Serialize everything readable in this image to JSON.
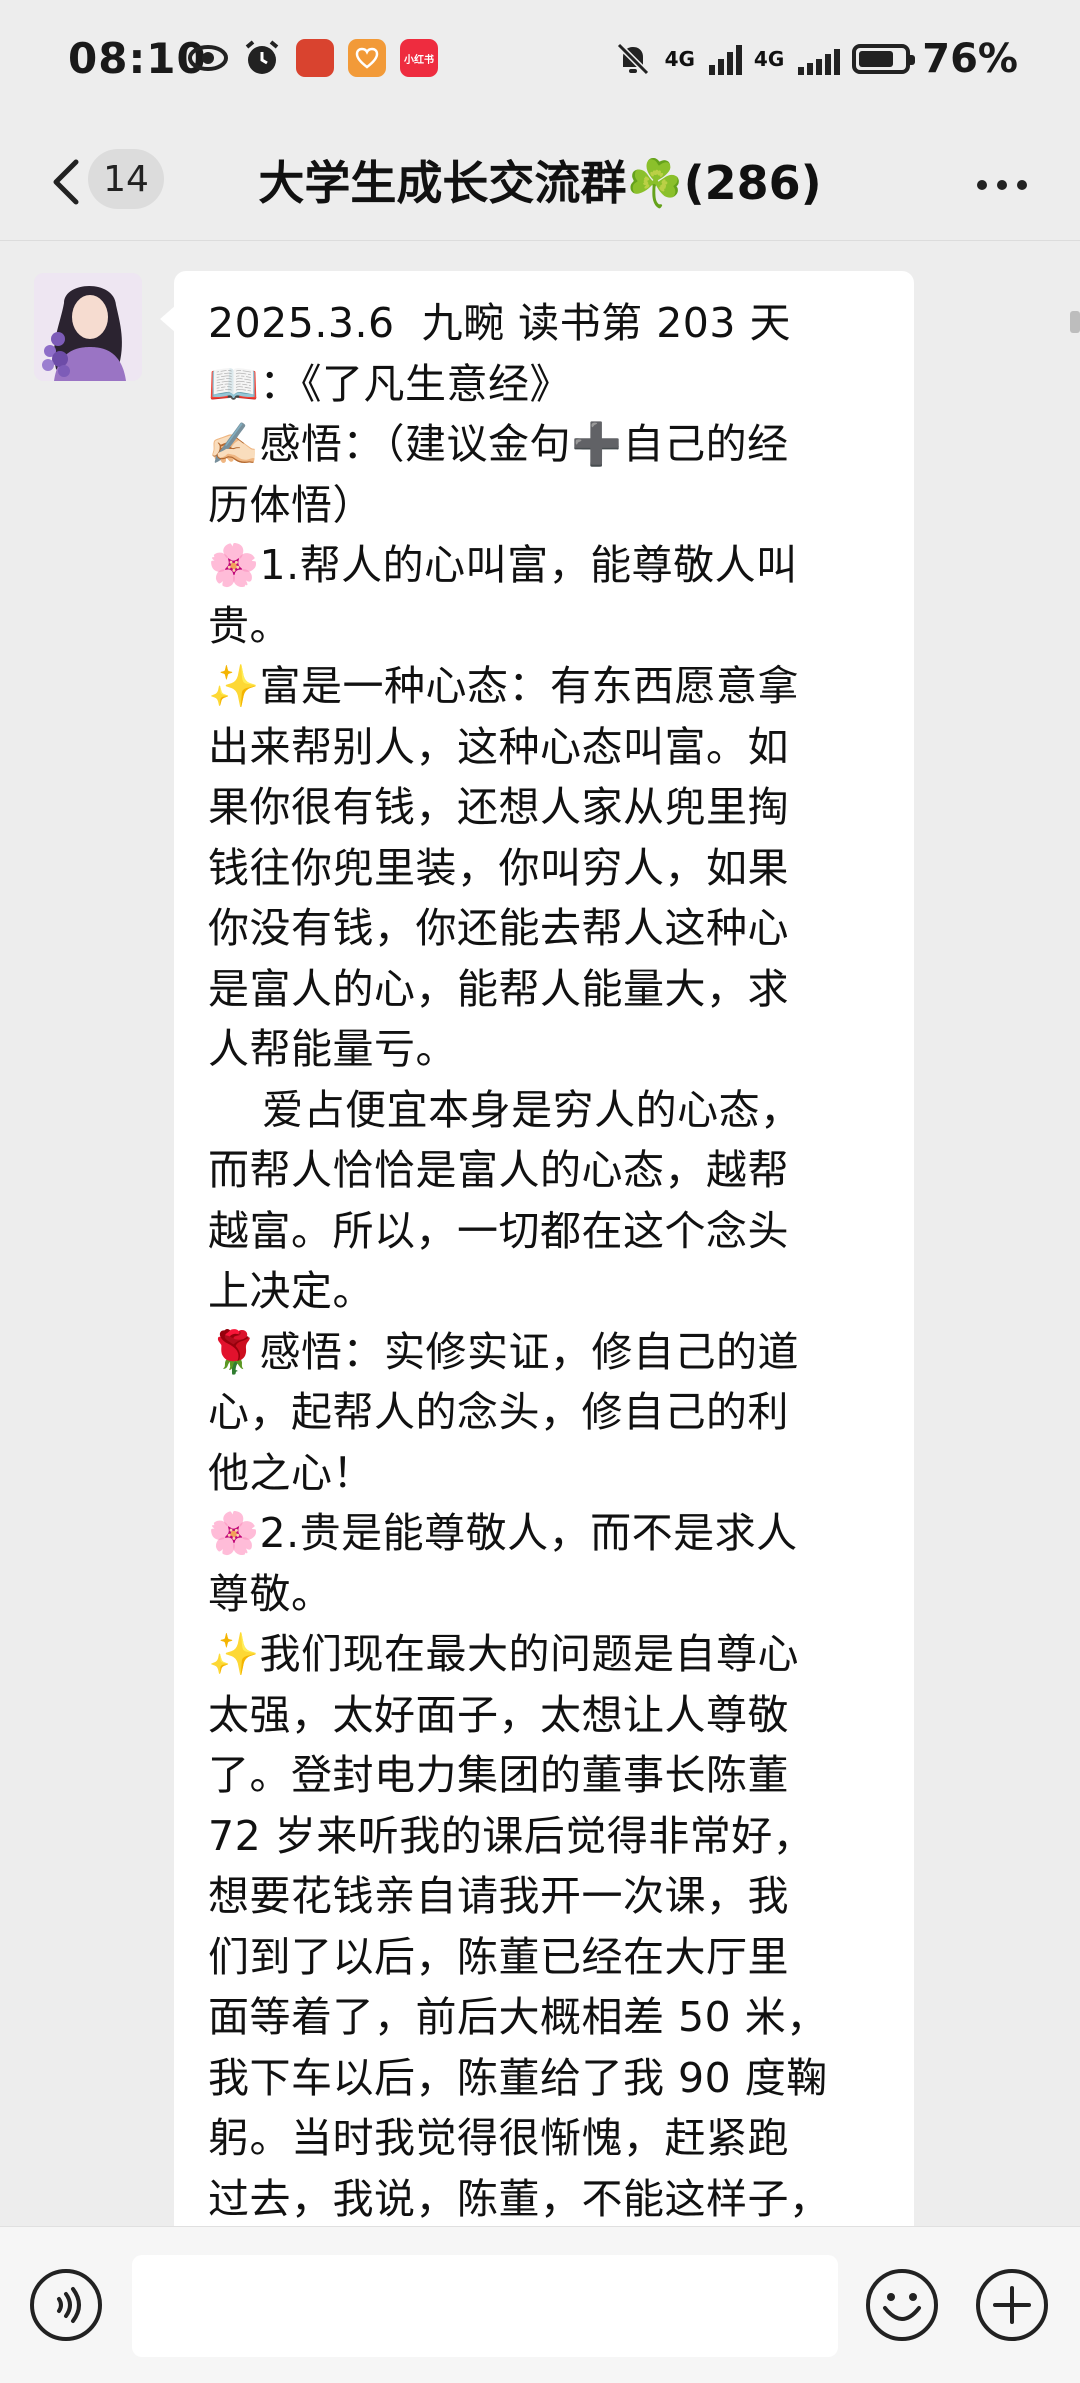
{
  "status_bar": {
    "time": "08:10",
    "network1": "4G",
    "network2": "4G",
    "battery_percent": "76%",
    "battery_level": 0.76,
    "app_icons": [
      {
        "name": "app-icon-1",
        "label": "",
        "color": "#d9432f"
      },
      {
        "name": "app-icon-2",
        "label": "",
        "color": "#f29a38"
      },
      {
        "name": "xiaohongshu-icon",
        "label": "小红书",
        "color": "#ee2c3f"
      }
    ]
  },
  "nav": {
    "unread_count": "14",
    "title": "大学生成长交流群☘️(286)"
  },
  "message": {
    "lines": [
      "2025.3.6  九畹 读书第 203 天",
      "📖：《了凡生意经》",
      "✍🏻感悟：（建议金句➕自己的经",
      "历体悟）",
      "🌸1.帮人的心叫富，能尊敬人叫",
      "贵。",
      "✨富是一种心态：有东西愿意拿",
      "出来帮别人，这种心态叫富。如",
      "果你很有钱，还想人家从兜里掏",
      "钱往你兜里装，你叫穷人，如果",
      "你没有钱，你还能去帮人这种心",
      "是富人的心，能帮人能量大，求",
      "人帮能量亏。",
      "    爱占便宜本身是穷人的心态，",
      "而帮人恰恰是富人的心态，越帮",
      "越富。所以，一切都在这个念头",
      "上决定。",
      "🌹感悟：实修实证，修自己的道",
      "心，起帮人的念头，修自己的利",
      "他之心！",
      "🌸2.贵是能尊敬人，而不是求人",
      "尊敬。",
      "✨我们现在最大的问题是自尊心",
      "太强，太好面子，太想让人尊敬",
      "了。登封电力集团的董事长陈董",
      "72 岁来听我的课后觉得非常好，",
      "想要花钱亲自请我开一次课，我",
      "们到了以后，陈董已经在大厅里",
      "面等着了，前后大概相差 50 米，",
      "我下车以后，陈董给了我 90 度鞠",
      "躬。当时我觉得很惭愧，赶紧跑",
      "过去，我说，陈董，不能这样子，"
    ]
  },
  "input": {
    "placeholder": "",
    "value": ""
  }
}
